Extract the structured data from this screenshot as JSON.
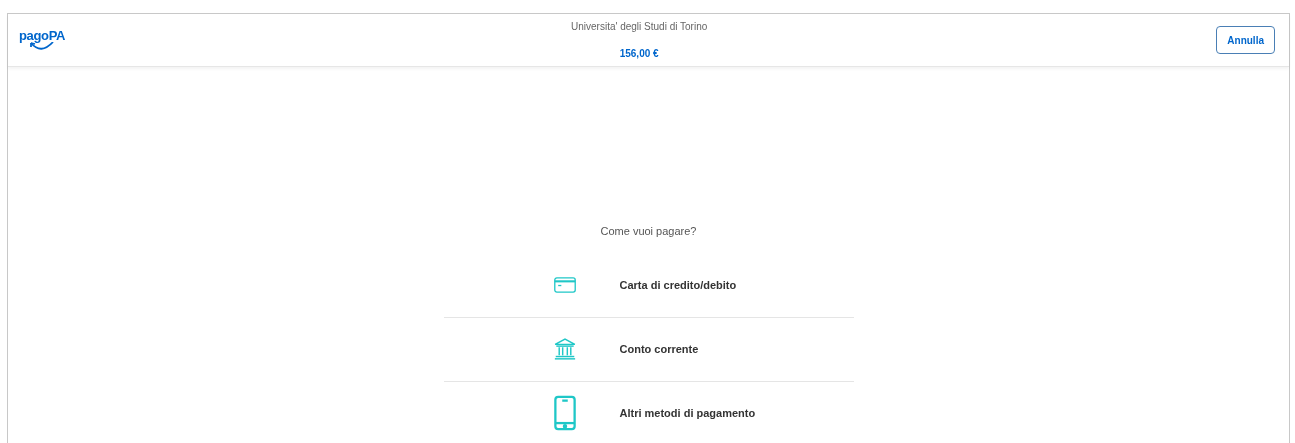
{
  "header": {
    "logo": "pagoPA",
    "payee": "Universita' degli Studi di Torino",
    "amount": "156,00 €",
    "cancel_button": "Annulla"
  },
  "question": "Come vuoi pagare?",
  "methods": [
    {
      "kind": "card",
      "label": "Carta di credito/debito"
    },
    {
      "kind": "bank",
      "label": "Conto corrente"
    },
    {
      "kind": "phone",
      "label": "Altri metodi di pagamento"
    }
  ]
}
